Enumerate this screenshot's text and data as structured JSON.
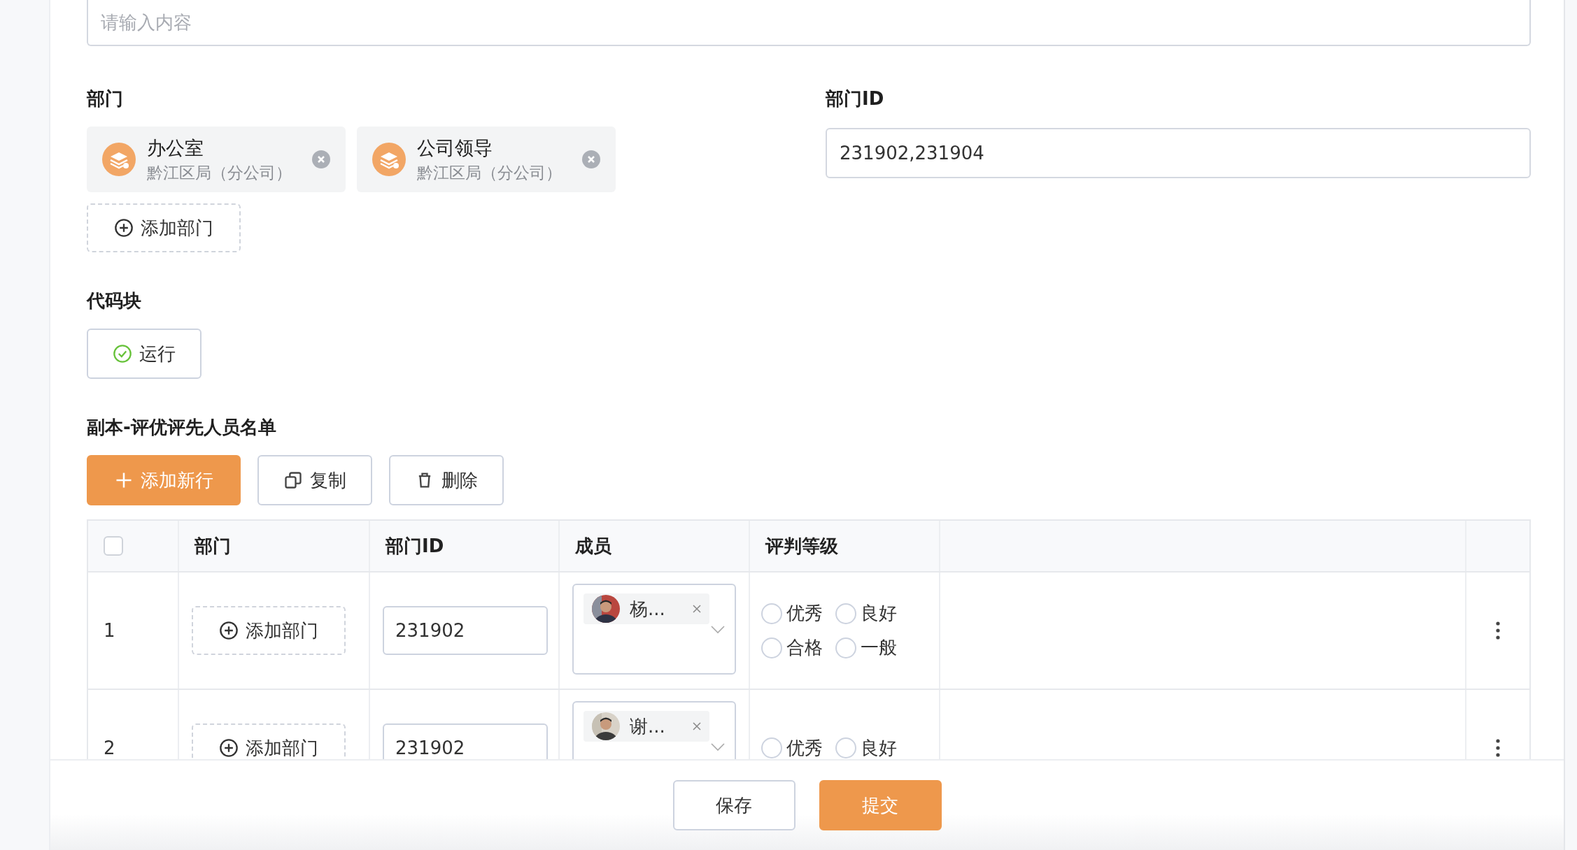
{
  "top_field": {
    "placeholder": "请输入内容"
  },
  "department": {
    "label": "部门",
    "chips": [
      {
        "name": "办公室",
        "org": "黔江区局（分公司）"
      },
      {
        "name": "公司领导",
        "org": "黔江区局（分公司）"
      }
    ],
    "add_button": "添加部门"
  },
  "department_id": {
    "label": "部门ID",
    "value": "231902,231904"
  },
  "code_block": {
    "label": "代码块",
    "run_button": "运行"
  },
  "table_section": {
    "title": "副本-评优评先人员名单",
    "actions": [
      {
        "label": "添加新行",
        "kind": "add"
      },
      {
        "label": "复制",
        "kind": "copy"
      },
      {
        "label": "删除",
        "kind": "delete"
      }
    ],
    "table": {
      "header_checkbox": {
        "checked": false
      },
      "columns": [
        "部门",
        "部门ID",
        "成员",
        "评判等级"
      ],
      "rows": [
        {
          "index": "1",
          "add_button": "添加部门",
          "dept_id": "231902",
          "member": "杨...",
          "grades": [
            {
              "label": "优秀",
              "selected": false
            },
            {
              "label": "良好",
              "selected": false
            },
            {
              "label": "合格",
              "selected": false
            },
            {
              "label": "一般",
              "selected": false
            }
          ]
        },
        {
          "index": "2",
          "add_button": "添加部门",
          "dept_id": "231902",
          "member": "谢...",
          "grades": [
            {
              "label": "优秀",
              "selected": false
            },
            {
              "label": "良好",
              "selected": false
            }
          ]
        }
      ]
    }
  },
  "footer": {
    "buttons": [
      {
        "label": "保存",
        "kind": "default"
      },
      {
        "label": "提交",
        "kind": "primary"
      }
    ]
  }
}
